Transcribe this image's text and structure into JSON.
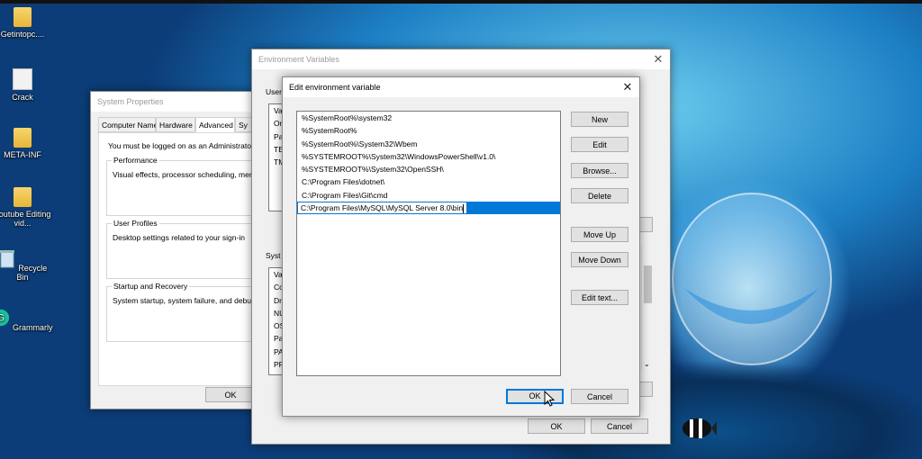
{
  "desktop": {
    "icons": [
      {
        "label": "Getintopc....",
        "icon": "folder-icon"
      },
      {
        "label": "Crack",
        "icon": "app-icon"
      },
      {
        "label": "META-INF",
        "icon": "folder-icon"
      },
      {
        "label": "Youtube Editing vid...",
        "icon": "folder-icon"
      },
      {
        "label": "Recycle Bin",
        "icon": "recycle-bin-icon"
      },
      {
        "label": "Grammarly",
        "icon": "grammarly-icon"
      }
    ]
  },
  "system_properties": {
    "title": "System Properties",
    "tabs": [
      "Computer Name",
      "Hardware",
      "Advanced",
      "Sy"
    ],
    "selected_tab": "Advanced",
    "admin_note": "You must be logged on as an Administrator to",
    "performance": {
      "label": "Performance",
      "text": "Visual effects, processor scheduling, memor"
    },
    "user_profiles": {
      "label": "User Profiles",
      "text": "Desktop settings related to your sign-in"
    },
    "startup_recovery": {
      "label": "Startup and Recovery",
      "text": "System startup, system failure, and debuggi"
    },
    "ok_label": "OK"
  },
  "environment_variables": {
    "title": "Environment Variables",
    "user_group_fragment": "User",
    "user_rows": [
      "Va",
      "On",
      "Pa",
      "TE",
      "TM"
    ],
    "system_group_fragment": "Syst",
    "system_rows": [
      "Va",
      "Co",
      "Dr",
      "NU",
      "OS",
      "Pa",
      "PA",
      "PR"
    ],
    "ok_label": "OK",
    "cancel_label": "Cancel"
  },
  "edit_dialog": {
    "title": "Edit environment variable",
    "entries": [
      "%SystemRoot%\\system32",
      "%SystemRoot%",
      "%SystemRoot%\\System32\\Wbem",
      "%SYSTEMROOT%\\System32\\WindowsPowerShell\\v1.0\\",
      "%SYSTEMROOT%\\System32\\OpenSSH\\",
      "C:\\Program Files\\dotnet\\",
      "C:\\Program Files\\Git\\cmd",
      "C:\\Program Files\\MySQL\\MySQL Server 8.0\\bin"
    ],
    "editing_index": 7,
    "buttons": {
      "new": "New",
      "edit": "Edit",
      "browse": "Browse...",
      "delete": "Delete",
      "move_up": "Move Up",
      "move_down": "Move Down",
      "edit_text": "Edit text..."
    },
    "ok_label": "OK",
    "cancel_label": "Cancel"
  }
}
